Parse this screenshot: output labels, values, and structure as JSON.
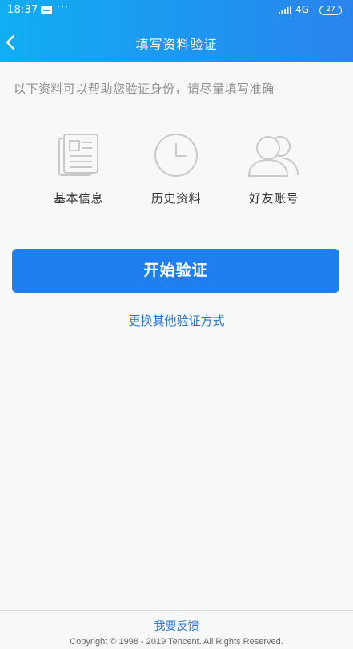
{
  "status_bar": {
    "time": "18:37",
    "dots": "···",
    "network": "4G",
    "battery": "27"
  },
  "header": {
    "title": "填写资料验证",
    "back_icon": "chevron-left-icon"
  },
  "intro_text": "以下资料可以帮助您验证身份，请尽量填写准确",
  "methods": [
    {
      "label": "基本信息",
      "icon": "document-icon"
    },
    {
      "label": "历史资料",
      "icon": "clock-icon"
    },
    {
      "label": "好友账号",
      "icon": "friends-icon"
    }
  ],
  "start_button_label": "开始验证",
  "alt_link_label": "更换其他验证方式",
  "footer": {
    "feedback_label": "我要反馈",
    "copyright": "Copyright © 1998 - 2019 Tencent. All Rights Reserved."
  },
  "colors": {
    "header_start": "#11aef2",
    "header_end": "#2a84ee",
    "primary_button": "#1f7ff0",
    "link": "#2a72d2"
  }
}
